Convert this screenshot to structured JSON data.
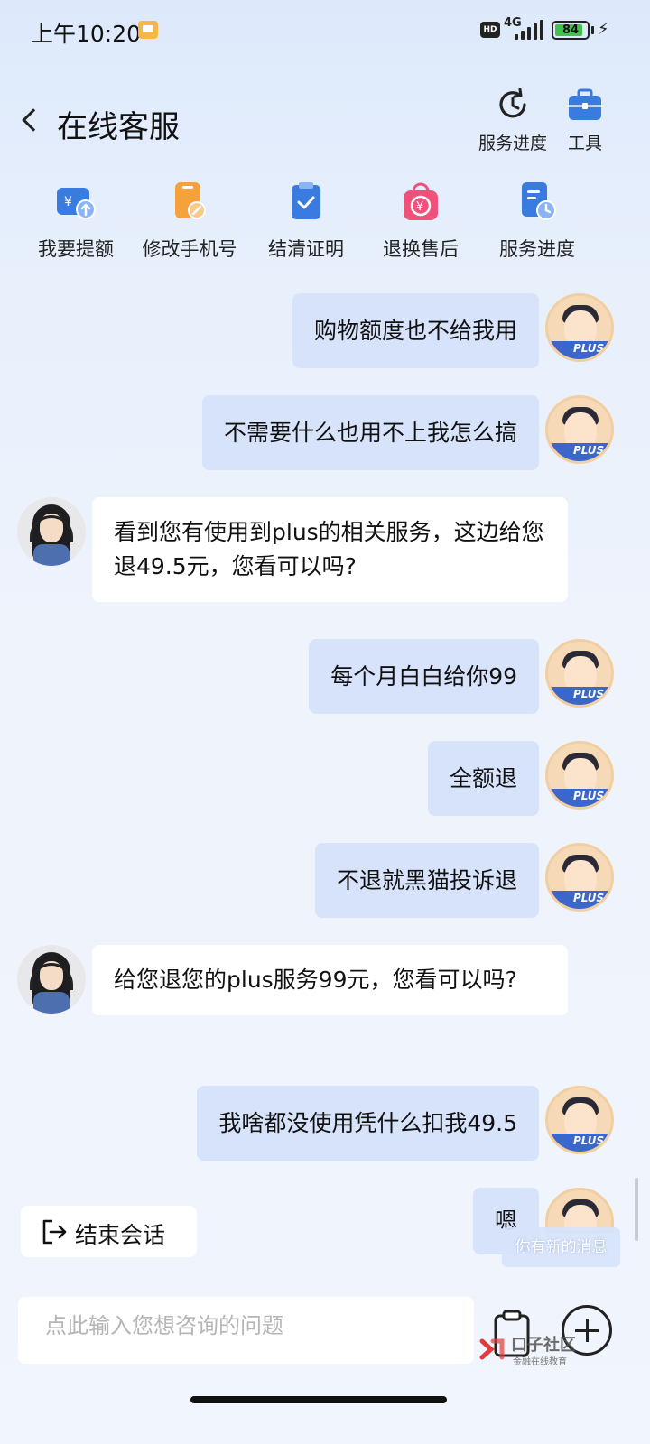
{
  "status_bar": {
    "time": "上午10:20",
    "network": "4G",
    "hd_badge": "HD",
    "battery": "84"
  },
  "header": {
    "title": "在线客服",
    "tools": [
      {
        "label": "服务进度",
        "icon": "clock-refresh-icon"
      },
      {
        "label": "工具",
        "icon": "toolbox-icon"
      }
    ]
  },
  "quick_services": [
    {
      "label": "我要提额",
      "icon": "wallet-up-icon"
    },
    {
      "label": "修改手机号",
      "icon": "phone-edit-icon"
    },
    {
      "label": "结清证明",
      "icon": "clipboard-check-icon"
    },
    {
      "label": "退换售后",
      "icon": "shopping-bag-yen-icon"
    },
    {
      "label": "服务进度",
      "icon": "document-clock-icon"
    }
  ],
  "messages": [
    {
      "from": "user",
      "text": "购物额度也不给我用"
    },
    {
      "from": "user",
      "text": "不需要什么也用不上我怎么搞"
    },
    {
      "from": "agent",
      "text": "看到您有使用到plus的相关服务，这边给您退49.5元，您看可以吗?"
    },
    {
      "from": "user",
      "text": "每个月白白给你99"
    },
    {
      "from": "user",
      "text": "全额退"
    },
    {
      "from": "user",
      "text": "不退就黑猫投诉退"
    },
    {
      "from": "agent",
      "text": "给您退您的plus服务99元，您看可以吗?"
    },
    {
      "from": "user",
      "text": "我啥都没使用凭什么扣我49.5"
    },
    {
      "from": "user",
      "text": "嗯"
    }
  ],
  "avatar_badge": "PLUS",
  "end_session": {
    "label": "结束会话"
  },
  "new_message_tip": "你有新的消息",
  "input": {
    "placeholder": "点此输入您想咨询的问题",
    "value": ""
  },
  "watermark": {
    "main": "口子社区",
    "sub": "金融在线教育"
  },
  "colors": {
    "user_bubble": "#d7e3fb",
    "agent_bubble": "#ffffff",
    "accent_blue": "#3a7be0",
    "accent_orange": "#f5a23c",
    "accent_pink": "#f0517a"
  }
}
